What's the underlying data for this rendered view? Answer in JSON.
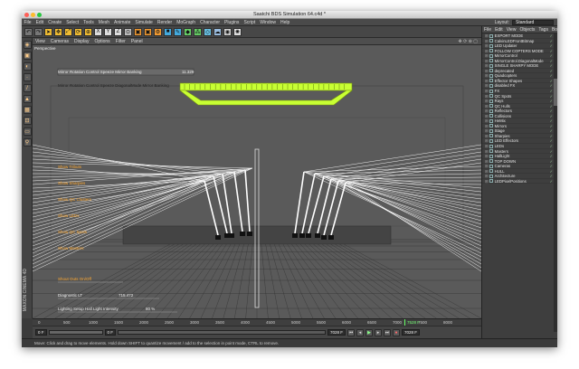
{
  "window": {
    "title": "Saatchi BDS Simulation 64.c4d *"
  },
  "menu": [
    "File",
    "Edit",
    "Create",
    "Select",
    "Tools",
    "Mesh",
    "Animate",
    "Simulate",
    "Render",
    "MoGraph",
    "Character",
    "Plugins",
    "Script",
    "Window",
    "Help"
  ],
  "layout": {
    "label": "Layout:",
    "value": "Standard"
  },
  "viewport_menu": [
    "View",
    "Cameras",
    "Display",
    "Options",
    "Filter",
    "Panel"
  ],
  "viewport": {
    "camera_label": "Perspective",
    "hud_top": "Mirror Rotation Control Speeze Mirror Banking",
    "hud_top_value": "11.329",
    "hud_green": "Mirror Rotation Control Speeze DiagonalMode Mirror Banking",
    "hud_left": [
      "Show Tributs",
      "Show Sharpies",
      "Show QC Clusters",
      "Show LEDs",
      "Show QC Spots",
      "Show Masters"
    ],
    "hud_bottom1": "Shout Outs On/Off",
    "hud_bottom2": "Diagnostic LT",
    "hud_bottom2_value": "715.472",
    "hud_bottom3": "Lighting Setup Hall Light Intensity",
    "hud_bottom3_value": "80 %"
  },
  "timeline": {
    "ticks": [
      "0",
      "500",
      "1000",
      "1500",
      "2000",
      "2500",
      "3000",
      "3500",
      "4000",
      "4500",
      "5000",
      "5500",
      "6000",
      "6500",
      "7000",
      "7500",
      "8000"
    ],
    "current_label": "7528 F"
  },
  "playbar": {
    "start": "0 F",
    "zoom": "0 F",
    "end": "7028 F",
    "end2": "7028 F"
  },
  "status": "Move: Click and drag to move elements. Hold down SHIFT to quantize movement / add to the selection in point mode, CTRL to remove.",
  "object_menu": [
    "File",
    "Edit",
    "View",
    "Objects",
    "Tags",
    "Bookmarks"
  ],
  "objects": [
    "EXPORT MODE",
    "CalvinLEDFrontBitmap",
    "LED Updater",
    "FOLLOW COPTERS MODE",
    "MirrorControl",
    "MirrorControl.DiagonalMode",
    "SINGLE SHARPY MODE",
    "deprecated",
    "Quadcopters",
    "Effector Shapes",
    "disabled FX",
    "FX",
    "QC Spots",
    "Rays",
    "QC Hulls",
    "Reflectors",
    "Collisions",
    "HeMix",
    "Mirrors",
    "Stage",
    "Sharpies",
    "LED Effectors",
    "LEDs",
    "Masters",
    "HallLight",
    "TOP DOWN",
    "Cameras",
    "HULL",
    "Architecture",
    "LEDPixelPositions"
  ],
  "left_label": "MAXON CINEMA 4D",
  "colors": {
    "accent": "#c8ff33",
    "hud_orange": "#ffaa33"
  }
}
